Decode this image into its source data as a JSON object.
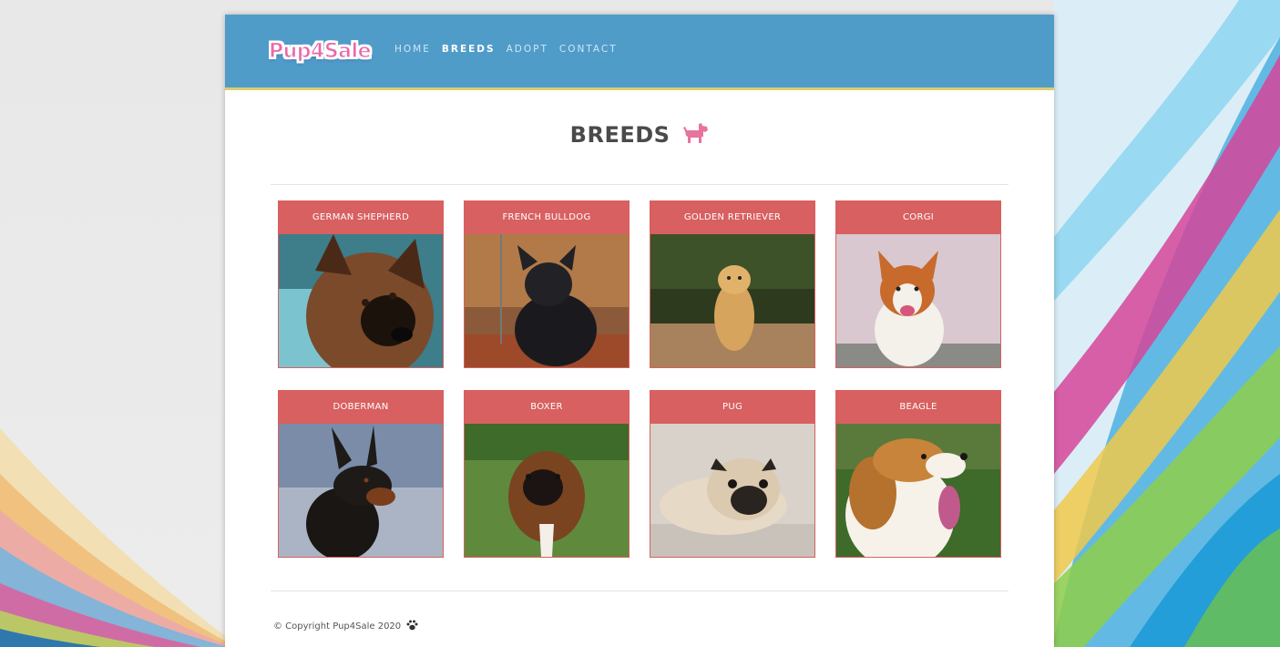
{
  "brand": {
    "logo_text": "Pup4Sale"
  },
  "nav": {
    "items": [
      {
        "label": "HOME"
      },
      {
        "label": "BREEDS"
      },
      {
        "label": "ADOPT"
      },
      {
        "label": "CONTACT"
      }
    ],
    "active": "BREEDS"
  },
  "page": {
    "title": "BREEDS",
    "title_icon": "dog-icon"
  },
  "breeds": [
    {
      "name": "GERMAN SHEPHERD"
    },
    {
      "name": "FRENCH BULLDOG"
    },
    {
      "name": "GOLDEN RETRIEVER"
    },
    {
      "name": "CORGI"
    },
    {
      "name": "DOBERMAN"
    },
    {
      "name": "BOXER"
    },
    {
      "name": "PUG"
    },
    {
      "name": "BEAGLE"
    }
  ],
  "footer": {
    "copyright": "© Copyright Pup4Sale 2020",
    "icon": "paw-icon"
  },
  "colors": {
    "header": "#509cc9",
    "header_border": "#d9cf6e",
    "card_header": "#d86060",
    "accent_pink": "#e968a8"
  }
}
